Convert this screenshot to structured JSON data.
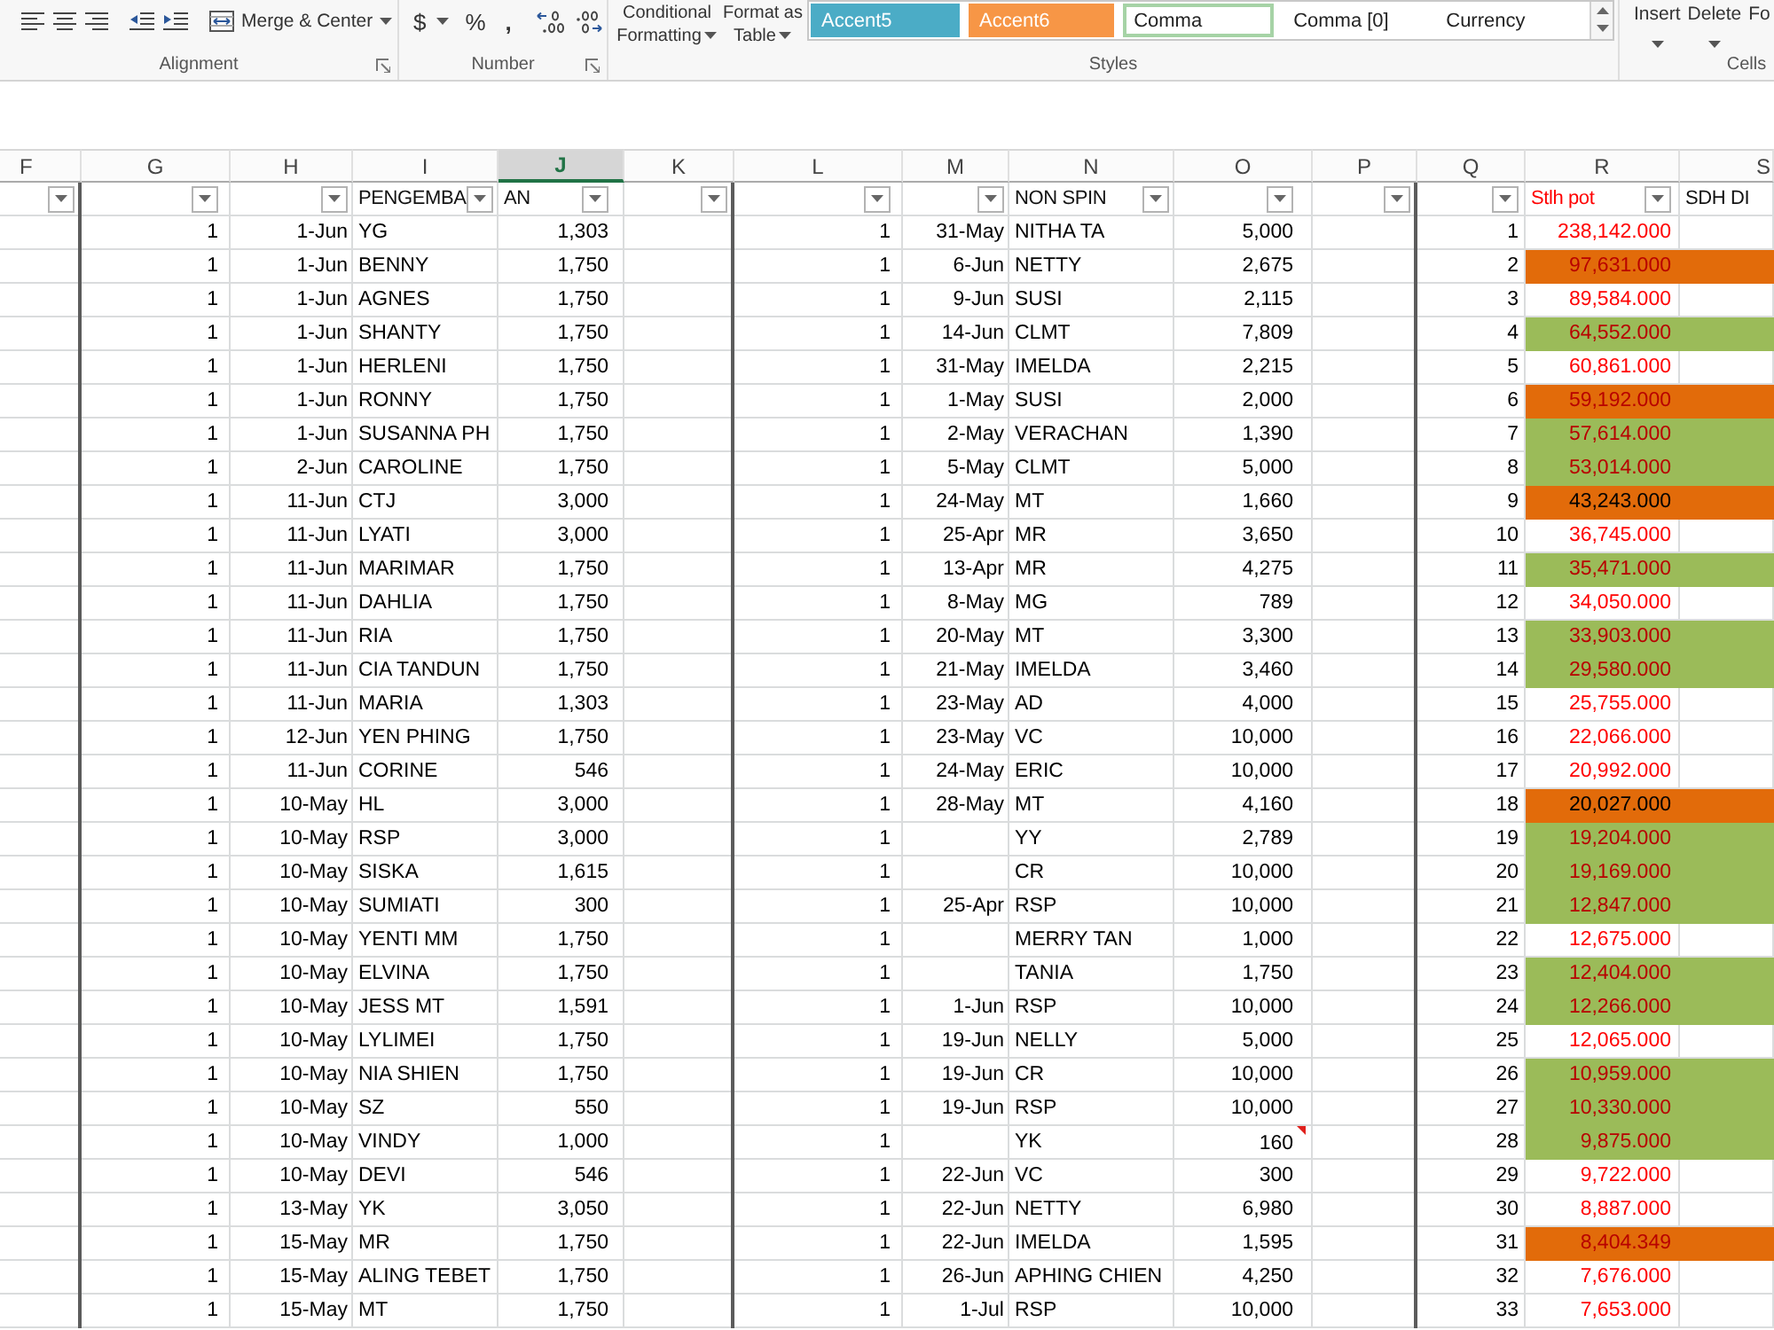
{
  "ribbon": {
    "groups": [
      {
        "kind": "alignment",
        "label": "Alignment",
        "merge_button": "Merge & Center"
      },
      {
        "kind": "number",
        "label": "Number",
        "currency_button": "$",
        "percent_button": "%",
        "comma_button": ","
      },
      {
        "kind": "styles",
        "label": "Styles",
        "conditional_formatting": "Conditional Formatting",
        "format_as_table": "Format as Table",
        "cell_styles": [
          {
            "label": "Accent5",
            "color": "#4bacc6",
            "selected": false
          },
          {
            "label": "Accent6",
            "color": "#f79646",
            "selected": false
          },
          {
            "label": "Comma",
            "selected": true
          },
          {
            "label": "Comma [0]",
            "selected": false
          },
          {
            "label": "Currency",
            "selected": false
          }
        ]
      },
      {
        "kind": "cells",
        "label": "Cells",
        "buttons": [
          {
            "label": "Insert",
            "dropdown": true
          },
          {
            "label": "Delete",
            "dropdown": true
          },
          {
            "label": "Fo",
            "dropdown": false
          }
        ]
      }
    ]
  },
  "column_headers": [
    {
      "label": "F",
      "selected": false
    },
    {
      "label": "G",
      "selected": false
    },
    {
      "label": "H",
      "selected": false
    },
    {
      "label": "I",
      "selected": false
    },
    {
      "label": "J",
      "selected": true
    },
    {
      "label": "K",
      "selected": false
    },
    {
      "label": "L",
      "selected": false
    },
    {
      "label": "M",
      "selected": false
    },
    {
      "label": "N",
      "selected": false
    },
    {
      "label": "O",
      "selected": false
    },
    {
      "label": "P",
      "selected": false
    },
    {
      "label": "Q",
      "selected": false
    },
    {
      "label": "R",
      "selected": false
    },
    {
      "label": "S",
      "selected": false
    }
  ],
  "filters": [
    {
      "dropdown": true
    },
    {
      "dropdown": true
    },
    {
      "dropdown": true
    },
    {
      "label": "PENGEMBA",
      "red_text": false,
      "dropdown": true
    },
    {
      "label": "AN",
      "red_text": false,
      "dropdown": true
    },
    {
      "dropdown": true
    },
    {
      "dropdown": true
    },
    {
      "dropdown": true
    },
    {
      "label": "NON SPIN",
      "red_text": false,
      "dropdown": true
    },
    {
      "dropdown": true
    },
    {
      "dropdown": true
    },
    {
      "dropdown": true
    },
    {
      "label": "Stlh pot",
      "red_text": true,
      "dropdown": true
    },
    {
      "label": "SDH DI",
      "red_text": false,
      "dropdown": false
    }
  ],
  "rows": [
    {
      "g": "1",
      "h": "1-Jun",
      "i": "YG",
      "j": "1,303",
      "l": "1",
      "m": "31-May",
      "n": "NITHA TA",
      "o": "5,000",
      "comment": false,
      "q": "1",
      "r": "238,142.000",
      "red_text": true
    },
    {
      "g": "1",
      "h": "1-Jun",
      "i": "BENNY",
      "j": "1,750",
      "l": "1",
      "m": "6-Jun",
      "n": "NETTY",
      "o": "2,675",
      "comment": false,
      "q": "2",
      "r": "97,631.000",
      "red_text": true,
      "color": "#e26b0a"
    },
    {
      "g": "1",
      "h": "1-Jun",
      "i": "AGNES",
      "j": "1,750",
      "l": "1",
      "m": "9-Jun",
      "n": "SUSI",
      "o": "2,115",
      "comment": false,
      "q": "3",
      "r": "89,584.000",
      "red_text": true
    },
    {
      "g": "1",
      "h": "1-Jun",
      "i": "SHANTY",
      "j": "1,750",
      "l": "1",
      "m": "14-Jun",
      "n": "CLMT",
      "o": "7,809",
      "comment": false,
      "q": "4",
      "r": "64,552.000",
      "red_text": true,
      "color": "#9bbb59"
    },
    {
      "g": "1",
      "h": "1-Jun",
      "i": "HERLENI",
      "j": "1,750",
      "l": "1",
      "m": "31-May",
      "n": "IMELDA",
      "o": "2,215",
      "comment": false,
      "q": "5",
      "r": "60,861.000",
      "red_text": true
    },
    {
      "g": "1",
      "h": "1-Jun",
      "i": "RONNY",
      "j": "1,750",
      "l": "1",
      "m": "1-May",
      "n": "SUSI",
      "o": "2,000",
      "comment": false,
      "q": "6",
      "r": "59,192.000",
      "red_text": true,
      "color": "#e26b0a"
    },
    {
      "g": "1",
      "h": "1-Jun",
      "i": "SUSANNA PH",
      "j": "1,750",
      "l": "1",
      "m": "2-May",
      "n": "VERACHAN",
      "o": "1,390",
      "comment": false,
      "q": "7",
      "r": "57,614.000",
      "red_text": true,
      "color": "#9bbb59"
    },
    {
      "g": "1",
      "h": "2-Jun",
      "i": "CAROLINE",
      "j": "1,750",
      "l": "1",
      "m": "5-May",
      "n": "CLMT",
      "o": "5,000",
      "comment": false,
      "q": "8",
      "r": "53,014.000",
      "red_text": true,
      "color": "#9bbb59"
    },
    {
      "g": "1",
      "h": "11-Jun",
      "i": "CTJ",
      "j": "3,000",
      "l": "1",
      "m": "24-May",
      "n": "MT",
      "o": "1,660",
      "comment": false,
      "q": "9",
      "r": "43,243.000",
      "red_text": false,
      "color": "#e26b0a"
    },
    {
      "g": "1",
      "h": "11-Jun",
      "i": "LYATI",
      "j": "3,000",
      "l": "1",
      "m": "25-Apr",
      "n": "MR",
      "o": "3,650",
      "comment": false,
      "q": "10",
      "r": "36,745.000",
      "red_text": true
    },
    {
      "g": "1",
      "h": "11-Jun",
      "i": "MARIMAR",
      "j": "1,750",
      "l": "1",
      "m": "13-Apr",
      "n": "MR",
      "o": "4,275",
      "comment": false,
      "q": "11",
      "r": "35,471.000",
      "red_text": true,
      "color": "#9bbb59"
    },
    {
      "g": "1",
      "h": "11-Jun",
      "i": "DAHLIA",
      "j": "1,750",
      "l": "1",
      "m": "8-May",
      "n": "MG",
      "o": "789",
      "comment": false,
      "q": "12",
      "r": "34,050.000",
      "red_text": true
    },
    {
      "g": "1",
      "h": "11-Jun",
      "i": "RIA",
      "j": "1,750",
      "l": "1",
      "m": "20-May",
      "n": "MT",
      "o": "3,300",
      "comment": false,
      "q": "13",
      "r": "33,903.000",
      "red_text": true,
      "color": "#9bbb59"
    },
    {
      "g": "1",
      "h": "11-Jun",
      "i": "CIA TANDUN",
      "j": "1,750",
      "l": "1",
      "m": "21-May",
      "n": "IMELDA",
      "o": "3,460",
      "comment": false,
      "q": "14",
      "r": "29,580.000",
      "red_text": true,
      "color": "#9bbb59"
    },
    {
      "g": "1",
      "h": "11-Jun",
      "i": "MARIA",
      "j": "1,303",
      "l": "1",
      "m": "23-May",
      "n": "AD",
      "o": "4,000",
      "comment": false,
      "q": "15",
      "r": "25,755.000",
      "red_text": true
    },
    {
      "g": "1",
      "h": "12-Jun",
      "i": "YEN PHING",
      "j": "1,750",
      "l": "1",
      "m": "23-May",
      "n": "VC",
      "o": "10,000",
      "comment": false,
      "q": "16",
      "r": "22,066.000",
      "red_text": true
    },
    {
      "g": "1",
      "h": "11-Jun",
      "i": "CORINE",
      "j": "546",
      "l": "1",
      "m": "24-May",
      "n": "ERIC",
      "o": "10,000",
      "comment": false,
      "q": "17",
      "r": "20,992.000",
      "red_text": true
    },
    {
      "g": "1",
      "h": "10-May",
      "i": "HL",
      "j": "3,000",
      "l": "1",
      "m": "28-May",
      "n": "MT",
      "o": "4,160",
      "comment": false,
      "q": "18",
      "r": "20,027.000",
      "red_text": false,
      "color": "#e26b0a"
    },
    {
      "g": "1",
      "h": "10-May",
      "i": "RSP",
      "j": "3,000",
      "l": "1",
      "n": "YY",
      "o": "2,789",
      "comment": false,
      "q": "19",
      "r": "19,204.000",
      "red_text": true,
      "color": "#9bbb59"
    },
    {
      "g": "1",
      "h": "10-May",
      "i": "SISKA",
      "j": "1,615",
      "l": "1",
      "n": "CR",
      "o": "10,000",
      "comment": false,
      "q": "20",
      "r": "19,169.000",
      "red_text": true,
      "color": "#9bbb59"
    },
    {
      "g": "1",
      "h": "10-May",
      "i": "SUMIATI",
      "j": "300",
      "l": "1",
      "m": "25-Apr",
      "n": "RSP",
      "o": "10,000",
      "comment": false,
      "q": "21",
      "r": "12,847.000",
      "red_text": true,
      "color": "#9bbb59"
    },
    {
      "g": "1",
      "h": "10-May",
      "i": "YENTI MM",
      "j": "1,750",
      "l": "1",
      "n": "MERRY TAN",
      "o": "1,000",
      "comment": false,
      "q": "22",
      "r": "12,675.000",
      "red_text": true
    },
    {
      "g": "1",
      "h": "10-May",
      "i": "ELVINA",
      "j": "1,750",
      "l": "1",
      "n": "TANIA",
      "o": "1,750",
      "comment": false,
      "q": "23",
      "r": "12,404.000",
      "red_text": true,
      "color": "#9bbb59"
    },
    {
      "g": "1",
      "h": "10-May",
      "i": "JESS MT",
      "j": "1,591",
      "l": "1",
      "m": "1-Jun",
      "n": "RSP",
      "o": "10,000",
      "comment": false,
      "q": "24",
      "r": "12,266.000",
      "red_text": true,
      "color": "#9bbb59"
    },
    {
      "g": "1",
      "h": "10-May",
      "i": "LYLIMEI",
      "j": "1,750",
      "l": "1",
      "m": "19-Jun",
      "n": "NELLY",
      "o": "5,000",
      "comment": false,
      "q": "25",
      "r": "12,065.000",
      "red_text": true
    },
    {
      "g": "1",
      "h": "10-May",
      "i": "NIA SHIEN",
      "j": "1,750",
      "l": "1",
      "m": "19-Jun",
      "n": "CR",
      "o": "10,000",
      "comment": false,
      "q": "26",
      "r": "10,959.000",
      "red_text": true,
      "color": "#9bbb59"
    },
    {
      "g": "1",
      "h": "10-May",
      "i": "SZ",
      "j": "550",
      "l": "1",
      "m": "19-Jun",
      "n": "RSP",
      "o": "10,000",
      "comment": false,
      "q": "27",
      "r": "10,330.000",
      "red_text": true,
      "color": "#9bbb59"
    },
    {
      "g": "1",
      "h": "10-May",
      "i": "VINDY",
      "j": "1,000",
      "l": "1",
      "n": "YK",
      "o": "160",
      "comment": true,
      "q": "28",
      "r": "9,875.000",
      "red_text": true,
      "color": "#9bbb59"
    },
    {
      "g": "1",
      "h": "10-May",
      "i": "DEVI",
      "j": "546",
      "l": "1",
      "m": "22-Jun",
      "n": "VC",
      "o": "300",
      "comment": false,
      "q": "29",
      "r": "9,722.000",
      "red_text": true
    },
    {
      "g": "1",
      "h": "13-May",
      "i": "YK",
      "j": "3,050",
      "l": "1",
      "m": "22-Jun",
      "n": "NETTY",
      "o": "6,980",
      "comment": false,
      "q": "30",
      "r": "8,887.000",
      "red_text": true
    },
    {
      "g": "1",
      "h": "15-May",
      "i": "MR",
      "j": "1,750",
      "l": "1",
      "m": "22-Jun",
      "n": "IMELDA",
      "o": "1,595",
      "comment": false,
      "q": "31",
      "r": "8,404.349",
      "red_text": true,
      "color": "#e26b0a"
    },
    {
      "g": "1",
      "h": "15-May",
      "i": "ALING TEBET",
      "j": "1,750",
      "l": "1",
      "m": "26-Jun",
      "n": "APHING CHIEN",
      "o": "4,250",
      "comment": false,
      "q": "32",
      "r": "7,676.000",
      "red_text": true
    },
    {
      "g": "1",
      "h": "15-May",
      "i": "MT",
      "j": "1,750",
      "l": "1",
      "m": "1-Jul",
      "n": "RSP",
      "o": "10,000",
      "comment": false,
      "q": "33",
      "r": "7,653.000",
      "red_text": true
    }
  ]
}
